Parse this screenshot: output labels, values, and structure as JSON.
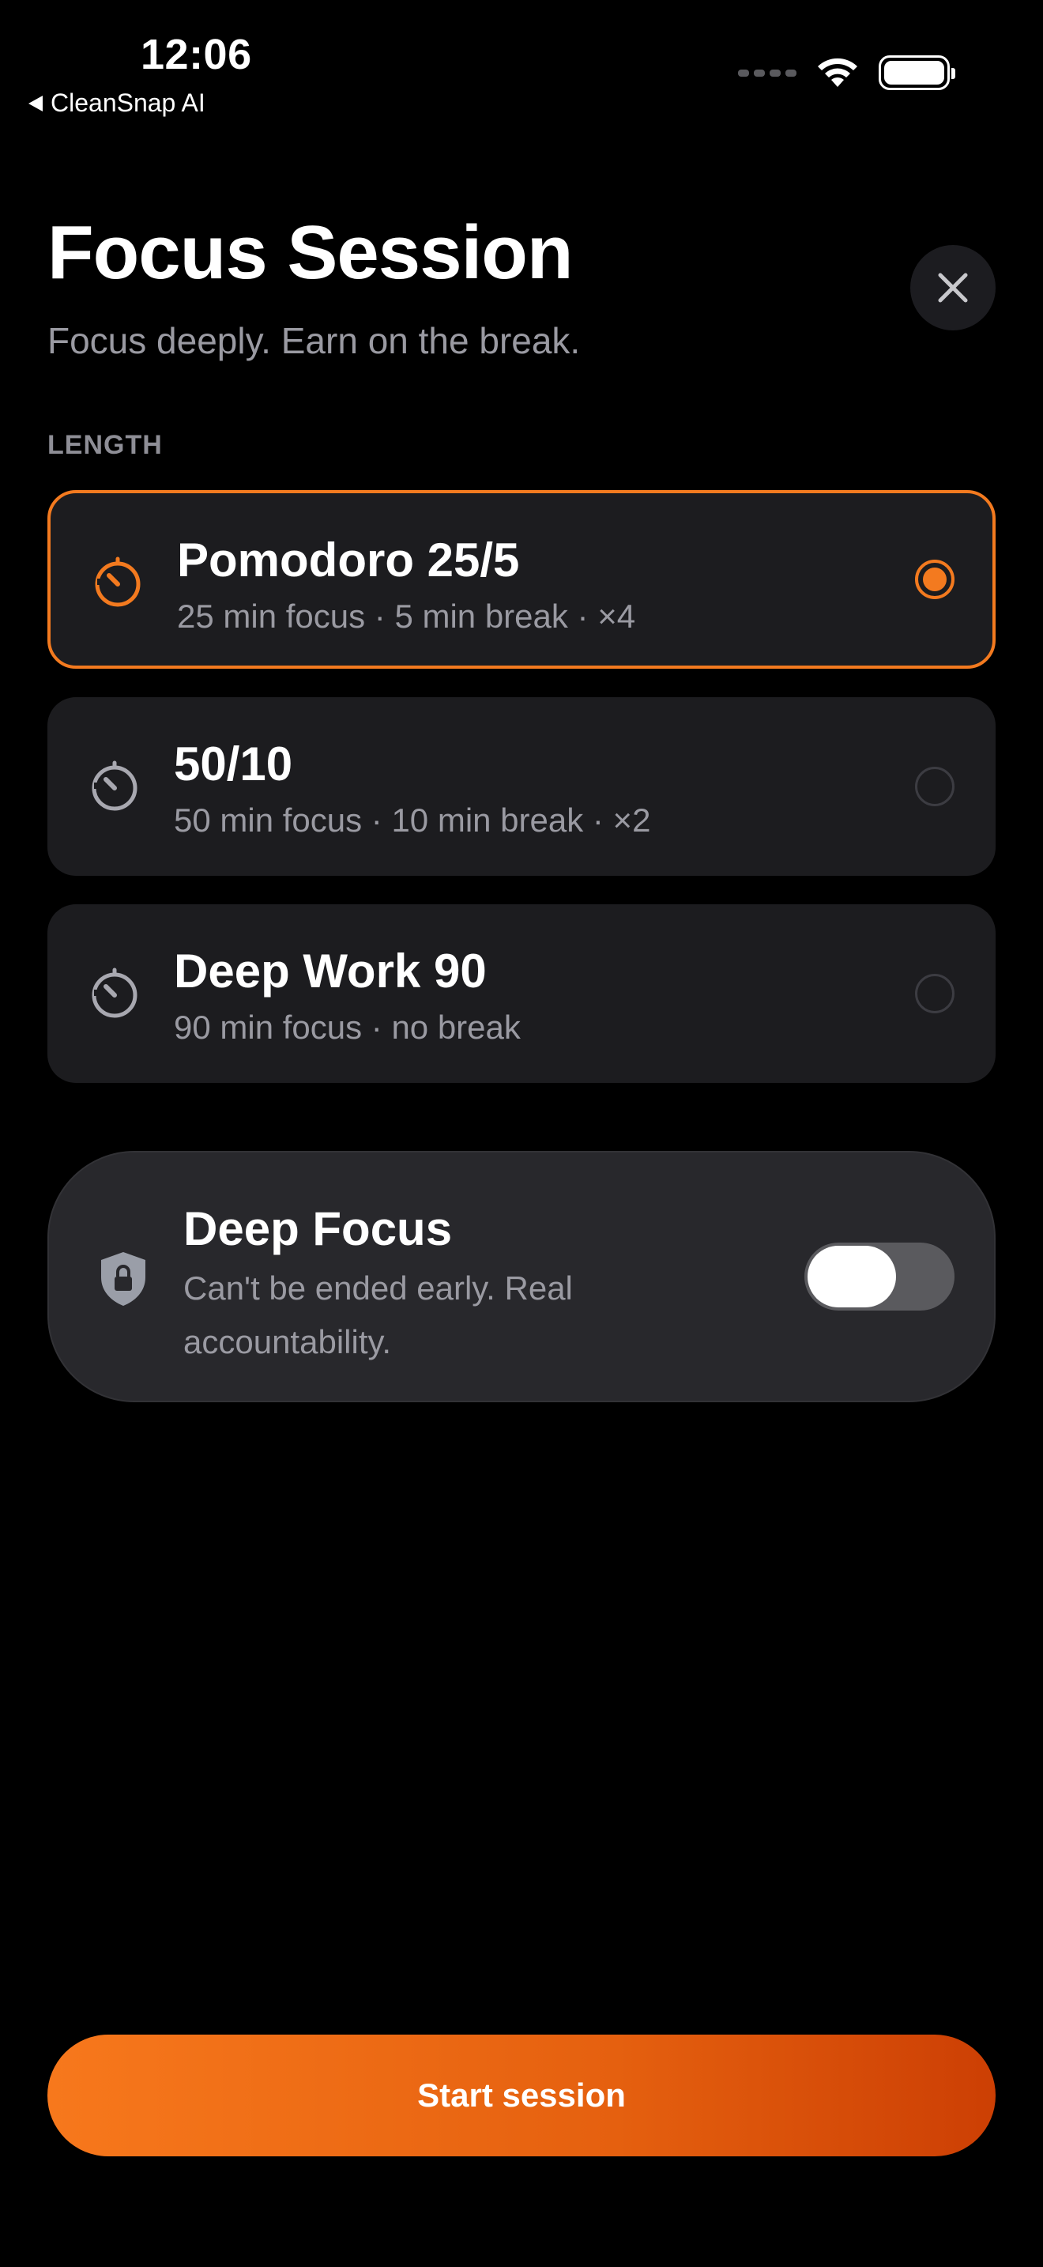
{
  "status_bar": {
    "time": "12:06",
    "back_app": "CleanSnap AI"
  },
  "header": {
    "title": "Focus Session",
    "subtitle": "Focus deeply. Earn on the break."
  },
  "length_section": {
    "label": "LENGTH",
    "options": [
      {
        "title": "Pomodoro 25/5",
        "description": "25 min focus · 5 min break · ×4",
        "selected": true,
        "icon": "timer-icon"
      },
      {
        "title": "50/10",
        "description": "50 min focus · 10 min break · ×2",
        "selected": false,
        "icon": "timer-icon"
      },
      {
        "title": "Deep Work 90",
        "description": "90 min focus · no break",
        "selected": false,
        "icon": "timer-icon"
      }
    ]
  },
  "deep_focus": {
    "title": "Deep Focus",
    "description": "Can't be ended early. Real accountability.",
    "enabled": false,
    "icon": "shield-lock-icon"
  },
  "start_button": {
    "label": "Start session"
  },
  "colors": {
    "accent": "#f37a1f",
    "background": "#000000",
    "card": "#1c1c1f",
    "secondary_text": "#9a9aa2"
  }
}
